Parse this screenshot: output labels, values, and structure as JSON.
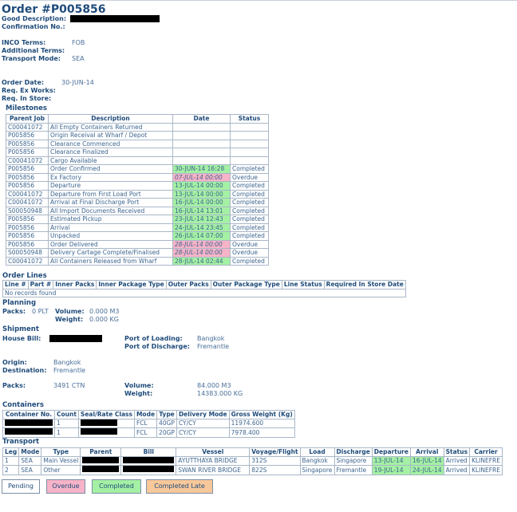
{
  "order": {
    "title": "Order #P005856",
    "good_description_label": "Good Description:",
    "confirmation_label": "Confirmation No.:",
    "inco_label": "INCO Terms:",
    "inco_value": "FOB",
    "additional_terms_label": "Additional Terms:",
    "transport_mode_label": "Transport Mode:",
    "transport_mode_value": "SEA",
    "order_date_label": "Order Date:",
    "order_date_value": "30-JUN-14",
    "req_ex_works_label": "Req. Ex Works:",
    "req_in_store_label": "Req. In Store:"
  },
  "milestones": {
    "heading": "Milestones",
    "headers": [
      "Parent Job",
      "Description",
      "Date",
      "Status"
    ],
    "rows": [
      {
        "job": "C00041072",
        "desc": "All Empty Containers Returned",
        "date": "",
        "status": "",
        "state": "pending"
      },
      {
        "job": "P005856",
        "desc": "Origin Receival at Wharf / Depot",
        "date": "",
        "status": "",
        "state": "pending"
      },
      {
        "job": "P005856",
        "desc": "Clearance Commenced",
        "date": "",
        "status": "",
        "state": "pending"
      },
      {
        "job": "P005856",
        "desc": "Clearance Finalized",
        "date": "",
        "status": "",
        "state": "pending"
      },
      {
        "job": "C00041072",
        "desc": "Cargo Available",
        "date": "",
        "status": "",
        "state": "pending"
      },
      {
        "job": "P005856",
        "desc": "Order Confirmed",
        "date": "30-JUN-14 16:28",
        "status": "Completed",
        "state": "completed"
      },
      {
        "job": "P005856",
        "desc": "Ex Factory",
        "date": "07-JUL-14 00:00",
        "status": "Overdue",
        "state": "overdue"
      },
      {
        "job": "P005856",
        "desc": "Departure",
        "date": "13-JUL-14 00:00",
        "status": "Completed",
        "state": "completed"
      },
      {
        "job": "C00041072",
        "desc": "Departure from First Load Port",
        "date": "13-JUL-14 00:00",
        "status": "Completed",
        "state": "completed"
      },
      {
        "job": "C00041072",
        "desc": "Arrival at Final Discharge Port",
        "date": "16-JUL-14 00:00",
        "status": "Completed",
        "state": "completed"
      },
      {
        "job": "S00050948",
        "desc": "All Import Documents Received",
        "date": "16-JUL-14 13:01",
        "status": "Completed",
        "state": "completed"
      },
      {
        "job": "P005856",
        "desc": "Estimated Pickup",
        "date": "23-JUL-14 12:43",
        "status": "Completed",
        "state": "completed"
      },
      {
        "job": "P005856",
        "desc": "Arrival",
        "date": "24-JUL-14 23:45",
        "status": "Completed",
        "state": "completed"
      },
      {
        "job": "P005856",
        "desc": "Unpacked",
        "date": "26-JUL-14 07:00",
        "status": "Completed",
        "state": "completed"
      },
      {
        "job": "P005856",
        "desc": "Order Delivered",
        "date": "28-JUL-14 00:00",
        "status": "Overdue",
        "state": "overdue"
      },
      {
        "job": "S00050948",
        "desc": "Delivery Cartage Complete/Finalised",
        "date": "28-JUL-14 00:00",
        "status": "Overdue",
        "state": "overdue"
      },
      {
        "job": "C00041072",
        "desc": "All Containers Released from Wharf",
        "date": "28-JUL-14 02:44",
        "status": "Completed",
        "state": "completed"
      }
    ]
  },
  "order_lines": {
    "heading": "Order Lines",
    "headers": [
      "Line #",
      "Part #",
      "Inner Packs",
      "Inner Package Type",
      "Outer Packs",
      "Outer Package Type",
      "Line Status",
      "Required In Store Date"
    ],
    "empty_text": "No records found"
  },
  "planning": {
    "heading": "Planning",
    "packs_label": "Packs:",
    "packs_value": "0 PLT",
    "volume_label": "Volume:",
    "volume_value": "0.000 M3",
    "weight_label": "Weight:",
    "weight_value": "0.000 KG"
  },
  "shipment": {
    "heading": "Shipment",
    "house_bill_label": "House Bill:",
    "port_loading_label": "Port of Loading:",
    "port_loading_value": "Bangkok",
    "port_discharge_label": "Port of Discharge:",
    "port_discharge_value": "Fremantle",
    "origin_label": "Origin:",
    "origin_value": "Bangkok",
    "destination_label": "Destination:",
    "destination_value": "Fremantle",
    "packs_label": "Packs:",
    "packs_value": "3491 CTN",
    "volume_label": "Volume:",
    "volume_value": "84.000 M3",
    "weight_label": "Weight:",
    "weight_value": "14383.000 KG"
  },
  "containers": {
    "heading": "Containers",
    "headers": [
      "Container No.",
      "Count",
      "Seal/Rate Class",
      "Mode",
      "Type",
      "Delivery Mode",
      "Gross Weight (Kg)"
    ],
    "rows": [
      {
        "count": "1",
        "mode": "FCL",
        "type": "40GP",
        "delivery": "CY/CY",
        "weight": "11974.600"
      },
      {
        "count": "1",
        "mode": "FCL",
        "type": "20GP",
        "delivery": "CY/CY",
        "weight": "7978.400"
      }
    ]
  },
  "transport": {
    "heading": "Transport",
    "headers": [
      "Leg",
      "Mode",
      "Type",
      "Parent",
      "Bill",
      "Vessel",
      "Voyage/Flight",
      "Load",
      "Discharge",
      "Departure",
      "Arrival",
      "Status",
      "Carrier"
    ],
    "rows": [
      {
        "leg": "1",
        "mode": "SEA",
        "type": "Main Vessel",
        "vessel": "AYUTTHAYA BRIDGE",
        "voyage": "312S",
        "load": "Bangkok",
        "discharge": "Singapore",
        "departure": "13-JUL-14",
        "arrival": "16-JUL-14",
        "status": "Arrived",
        "carrier": "KLINEFRE"
      },
      {
        "leg": "2",
        "mode": "SEA",
        "type": "Other",
        "vessel": "SWAN RIVER BRIDGE",
        "voyage": "822S",
        "load": "Singapore",
        "discharge": "Fremantle",
        "departure": "19-JUL-14",
        "arrival": "24-JUL-14",
        "status": "Arrived",
        "carrier": "KLINEFRE"
      }
    ]
  },
  "legend": {
    "pending": "Pending",
    "overdue": "Overdue",
    "completed": "Completed",
    "completed_late": "Completed Late",
    "colors": {
      "pending": "#ffffff",
      "overdue": "#f7b3c8",
      "completed": "#a4f0a4",
      "completed_late": "#f8c89a"
    }
  }
}
